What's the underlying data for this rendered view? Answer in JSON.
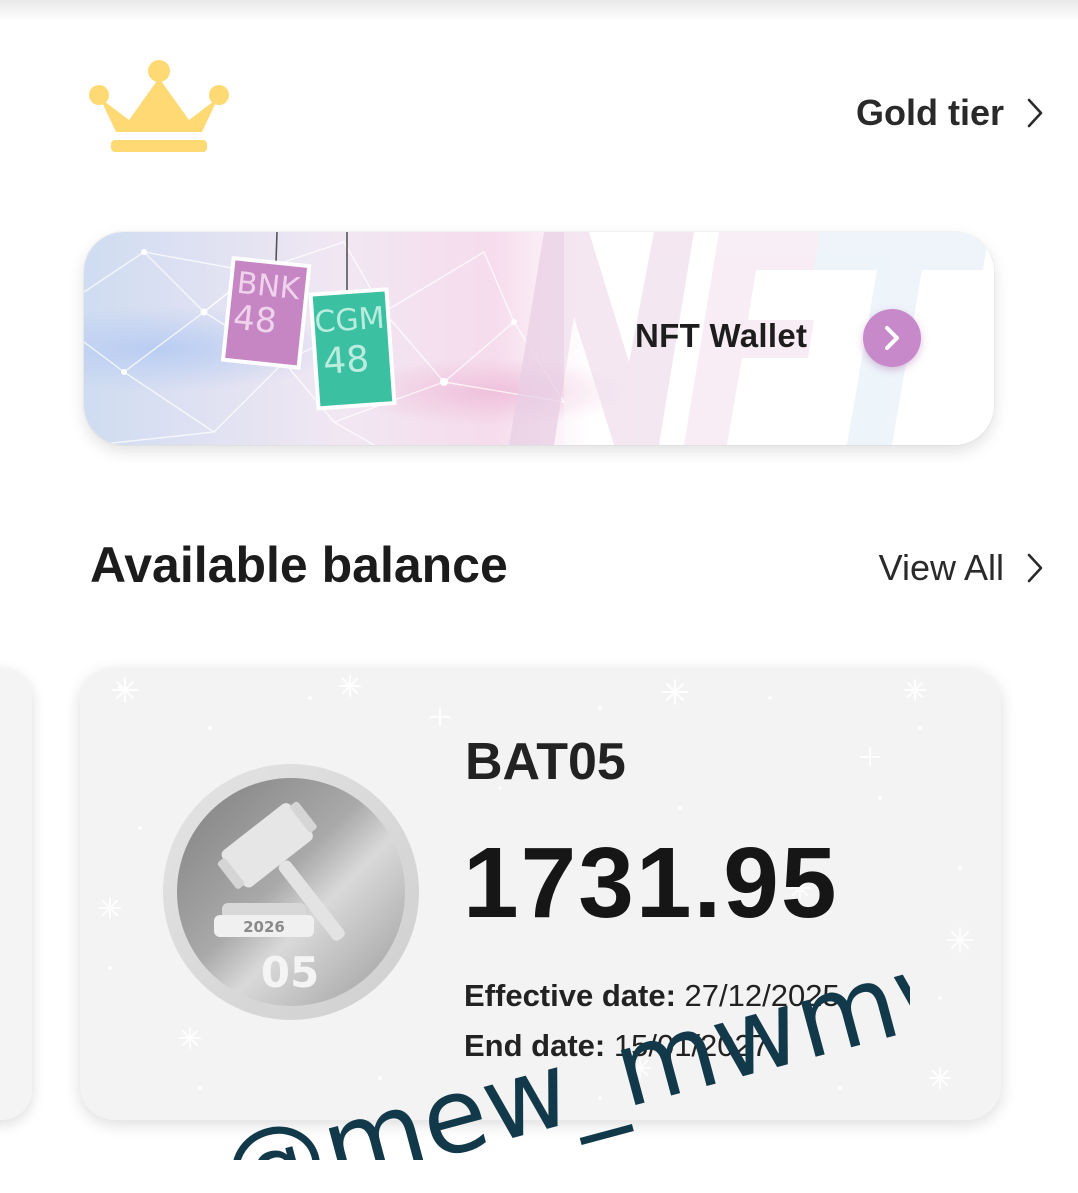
{
  "tier": {
    "icon": "crown-icon",
    "label": "Gold tier",
    "icon_color": "#ffd974"
  },
  "nft_banner": {
    "label": "NFT Wallet",
    "background_text": "NFT",
    "cards": [
      "BNK 48",
      "CGM 48"
    ],
    "arrow_color": "#c789c9"
  },
  "balance_section": {
    "title": "Available balance",
    "view_all": "View All"
  },
  "balance_card": {
    "coin_icon": "gavel-coin-icon",
    "coin_year": "2026",
    "coin_number": "05",
    "code": "BAT05",
    "amount": "1731.95",
    "effective_label": "Effective date:",
    "effective_value": "27/12/2025",
    "end_label": "End date:",
    "end_value": "15/01/2027"
  },
  "watermark": {
    "text": "@mew_mwmw"
  }
}
